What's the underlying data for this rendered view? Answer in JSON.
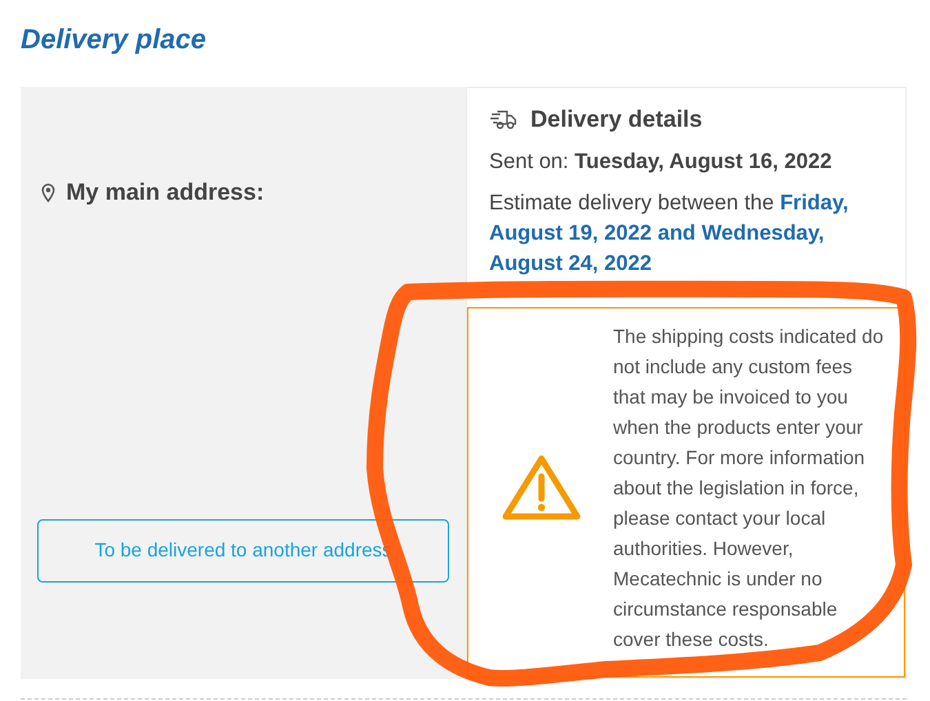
{
  "title": "Delivery place",
  "address_panel": {
    "heading": "My main address:",
    "button": "To be delivered to another address"
  },
  "details": {
    "heading": "Delivery details",
    "sent_on": "Sent on: **Tuesday, August 16, 2022**",
    "estimate": "Estimate delivery between the **Friday, August 19, 2022 and Wednesday, August 24, 2022**"
  },
  "notice": {
    "text": "The shipping costs indicated do not include any custom fees that may be invoiced to you when the products enter your country. For more information about the legislation in force, please contact your local authorities. However, Mecatechnic is under no circumstance responsable cover these costs."
  }
}
